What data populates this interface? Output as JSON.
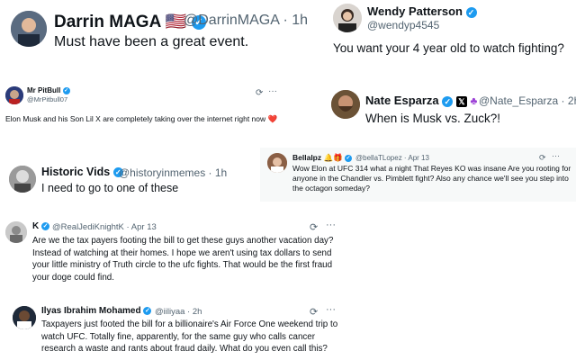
{
  "tweets": [
    {
      "name": "Darrin MAGA",
      "flag": "🇺🇸",
      "handle": "@DarrinMAGA · 1h",
      "text": "Must have been a great event."
    },
    {
      "name": "Wendy Patterson",
      "handle": "@wendyp4545",
      "text": "You want your 4 year old to watch fighting?"
    },
    {
      "name": "Mr PitBull",
      "handle": "@MrPitbull07",
      "text": "Elon Musk and his Son Lil X are completely taking over the internet right now",
      "heart": "❤️",
      "more": "···"
    },
    {
      "name": "Nate Esparza",
      "handle": "@Nate_Esparza · 2h",
      "text": "When is Musk vs. Zuck?!"
    },
    {
      "name": "Bellalpz",
      "emoji": "🔔🎁",
      "handle": "@bellaTLopez · Apr 13",
      "text": "Wow Elon at UFC 314 what a night That Reyes KO was insane  Are you rooting for anyone in the Chandler vs. Pimblett fight? Also any chance we'll see you step into the octagon someday?",
      "more": "···"
    },
    {
      "name": "Historic Vids",
      "handle": "@historyinmemes · 1h",
      "text": "I need to go to one of these"
    },
    {
      "name": "K",
      "handle": "@RealJediKnightK · Apr 13",
      "text": "Are we the tax payers footing the bill to get these guys another vacation day? Instead of watching at their homes. I hope we aren't using tax dollars to send your little ministry of Truth circle to the ufc fights. That would be the first fraud your doge could find.",
      "more": "···"
    },
    {
      "name": "Ilyas Ibrahim Mohamed",
      "handle": "@iiliyaa · 2h",
      "text": "Taxpayers just footed the bill for a billionaire's Air Force One weekend trip to watch UFC. Totally fine, apparently, for the same guy who calls cancer research a waste and rants about fraud daily. What do you even call this?",
      "more": "···"
    }
  ],
  "colors": {
    "verified": "#1d9bf0",
    "muted": "#536471",
    "text": "#0f1419"
  },
  "icons": {
    "verified": "verified-badge-icon",
    "grok": "grok-icon",
    "more": "more-icon"
  }
}
